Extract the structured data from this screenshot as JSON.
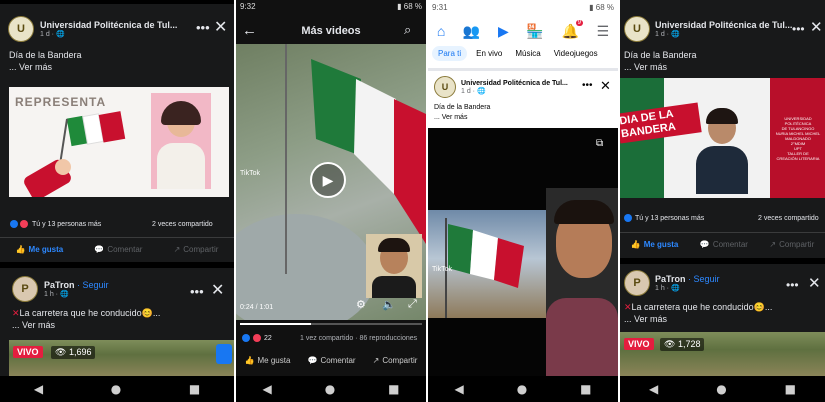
{
  "post1": {
    "page_name": "Universidad Politécnica de Tul...",
    "time": "1 d · 🌐",
    "text": "Día de la Bandera",
    "see_more": "... Ver más",
    "image_text": "REPRESENTA",
    "reactions": "Tú y 13 personas más",
    "shares": "2 veces compartido",
    "like": "Me gusta",
    "comment": "Comentar",
    "share": "Compartir"
  },
  "post2": {
    "name": "PaTron",
    "follow": "· Seguir",
    "time": "1 h · 🌐",
    "text": "La carretera que he conducido😊...",
    "see_more": "... Ver más",
    "live": "VIVO",
    "views": "1,696"
  },
  "video_screen": {
    "status_time": "9:32",
    "battery": "68 %",
    "title": "Más videos",
    "tiktok": "TikTok",
    "progress": "0:24 / 1:01",
    "progress_fraction": 0.39,
    "reaction_count": "22",
    "stats": "1 vez compartido · 86 reproducciones",
    "like": "Me gusta",
    "comment": "Comentar",
    "share": "Compartir"
  },
  "tabs_screen": {
    "status_time": "9:31",
    "battery": "68 %",
    "notification_count": "9",
    "tabs": [
      "Para ti",
      "En vivo",
      "Música",
      "Videojuegos"
    ],
    "page_name": "Universidad Politécnica de Tul...",
    "time": "1 d · 🌐",
    "text": "Día de la Bandera",
    "see_more": "... Ver más",
    "tiktok": "TikTok"
  },
  "post4": {
    "page_name": "Universidad Politécnica de Tul...",
    "time": "1 d · 🌐",
    "text": "Día de la Bandera",
    "see_more": "... Ver más",
    "banner": "DIA DE LA BANDERA",
    "caption_lines": [
      "UNIVERSIDAD POLITÉCNICA",
      "DE TULANCINGO",
      "NURIA MICHEL MICHEL",
      "MALDONADO",
      "2°MDIM",
      "UPT",
      "TALLER DE",
      "CREACIÓN LITERARIA"
    ],
    "reactions": "Tú y 13 personas más",
    "shares": "2 veces compartido",
    "like": "Me gusta",
    "comment": "Comentar",
    "share": "Compartir"
  },
  "post5": {
    "name": "PaTron",
    "follow": "· Seguir",
    "time": "1 h · 🌐",
    "text": "La carretera que he conducido😊...",
    "see_more": "... Ver más",
    "live": "VIVO",
    "views": "1,728"
  },
  "icons": {
    "back": "back-icon",
    "search": "search-icon",
    "close": "close-icon",
    "more": "more-icon",
    "home": "home-icon",
    "friends": "friends-icon",
    "watch": "watch-icon",
    "market": "marketplace-icon",
    "bell": "notification-icon",
    "menu": "menu-icon",
    "play": "play-icon"
  },
  "nav": {
    "back": "◀",
    "home": "●",
    "recent": "■"
  }
}
